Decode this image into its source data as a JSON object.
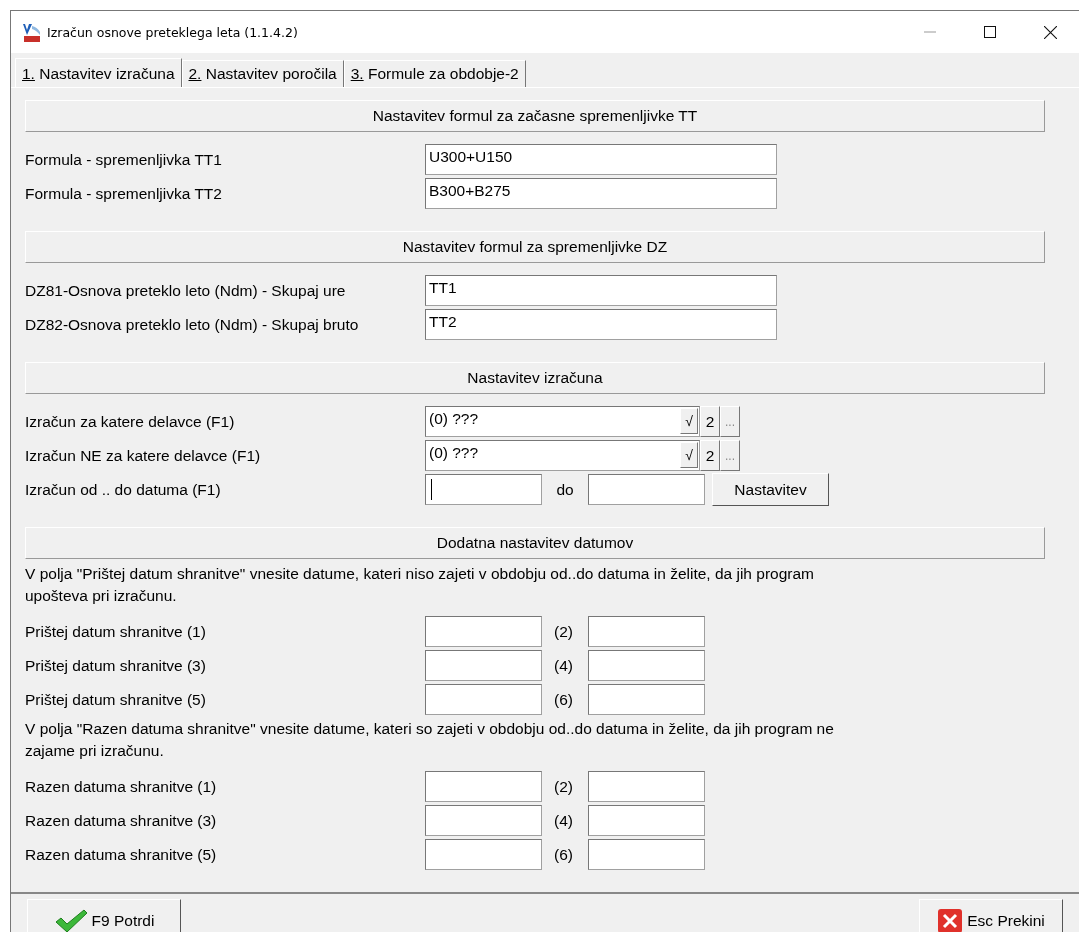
{
  "window": {
    "title": "Izračun osnove preteklega leta  (1.1.4.2)"
  },
  "tabs": [
    {
      "label": "1. Nastavitev izračuna",
      "selected": true
    },
    {
      "label": "2. Nastavitev poročila",
      "selected": false
    },
    {
      "label": "3. Formule za obdobje-2",
      "selected": false
    }
  ],
  "sections": [
    {
      "header": "Nastavitev formul za začasne spremenljivke TT",
      "rows": [
        {
          "kind": "field",
          "label": "Formula - spremenljivka TT1",
          "value": "U300+U150"
        },
        {
          "kind": "field",
          "label": "Formula - spremenljivka TT2",
          "value": "B300+B275"
        }
      ]
    },
    {
      "header": "Nastavitev formul za spremenljivke DZ",
      "rows": [
        {
          "kind": "field",
          "label": "DZ81-Osnova preteklo leto (Ndm) - Skupaj ure",
          "value": "TT1"
        },
        {
          "kind": "field",
          "label": "DZ82-Osnova preteklo leto (Ndm) - Skupaj bruto",
          "value": "TT2"
        }
      ]
    },
    {
      "header": "Nastavitev izračuna",
      "rows": [
        {
          "kind": "combo",
          "label": "Izračun za katere delavce (F1)",
          "value": "(0) ???",
          "check": "√",
          "count": "2",
          "more": "..."
        },
        {
          "kind": "combo",
          "label": "Izračun NE za katere delavce (F1)",
          "value": "(0) ???",
          "check": "√",
          "count": "2",
          "more": "..."
        },
        {
          "kind": "range",
          "label": "Izračun od .. do datuma (F1)",
          "focused": true,
          "sep": "do",
          "button": "Nastavitev"
        }
      ]
    },
    {
      "header": "Dodatna nastavitev datumov",
      "rows": [
        {
          "kind": "note",
          "text": "V polja \"Prištej datum shranitve\" vnesite datume, kateri niso zajeti v obdobju od..do datuma in želite, da jih program upošteva pri izračunu."
        },
        {
          "kind": "pair",
          "label": "Prištej datum shranitve (1)",
          "sep": "(2)"
        },
        {
          "kind": "pair",
          "label": "Prištej datum shranitve (3)",
          "sep": "(4)"
        },
        {
          "kind": "pair",
          "label": "Prištej datum shranitve (5)",
          "sep": "(6)"
        },
        {
          "kind": "note",
          "text": "V polja \"Razen datuma shranitve\" vnesite datume, kateri so zajeti v obdobju od..do datuma in želite, da jih program ne zajame pri izračunu."
        },
        {
          "kind": "pair",
          "label": "Razen datuma shranitve (1)",
          "sep": "(2)"
        },
        {
          "kind": "pair",
          "label": "Razen datuma shranitve (3)",
          "sep": "(4)"
        },
        {
          "kind": "pair",
          "label": "Razen datuma shranitve (5)",
          "sep": "(6)"
        }
      ]
    }
  ],
  "footer": [
    {
      "kind": "confirm",
      "label": "F9 Potrdi"
    },
    {
      "kind": "cancel",
      "label": "Esc Prekini"
    }
  ]
}
